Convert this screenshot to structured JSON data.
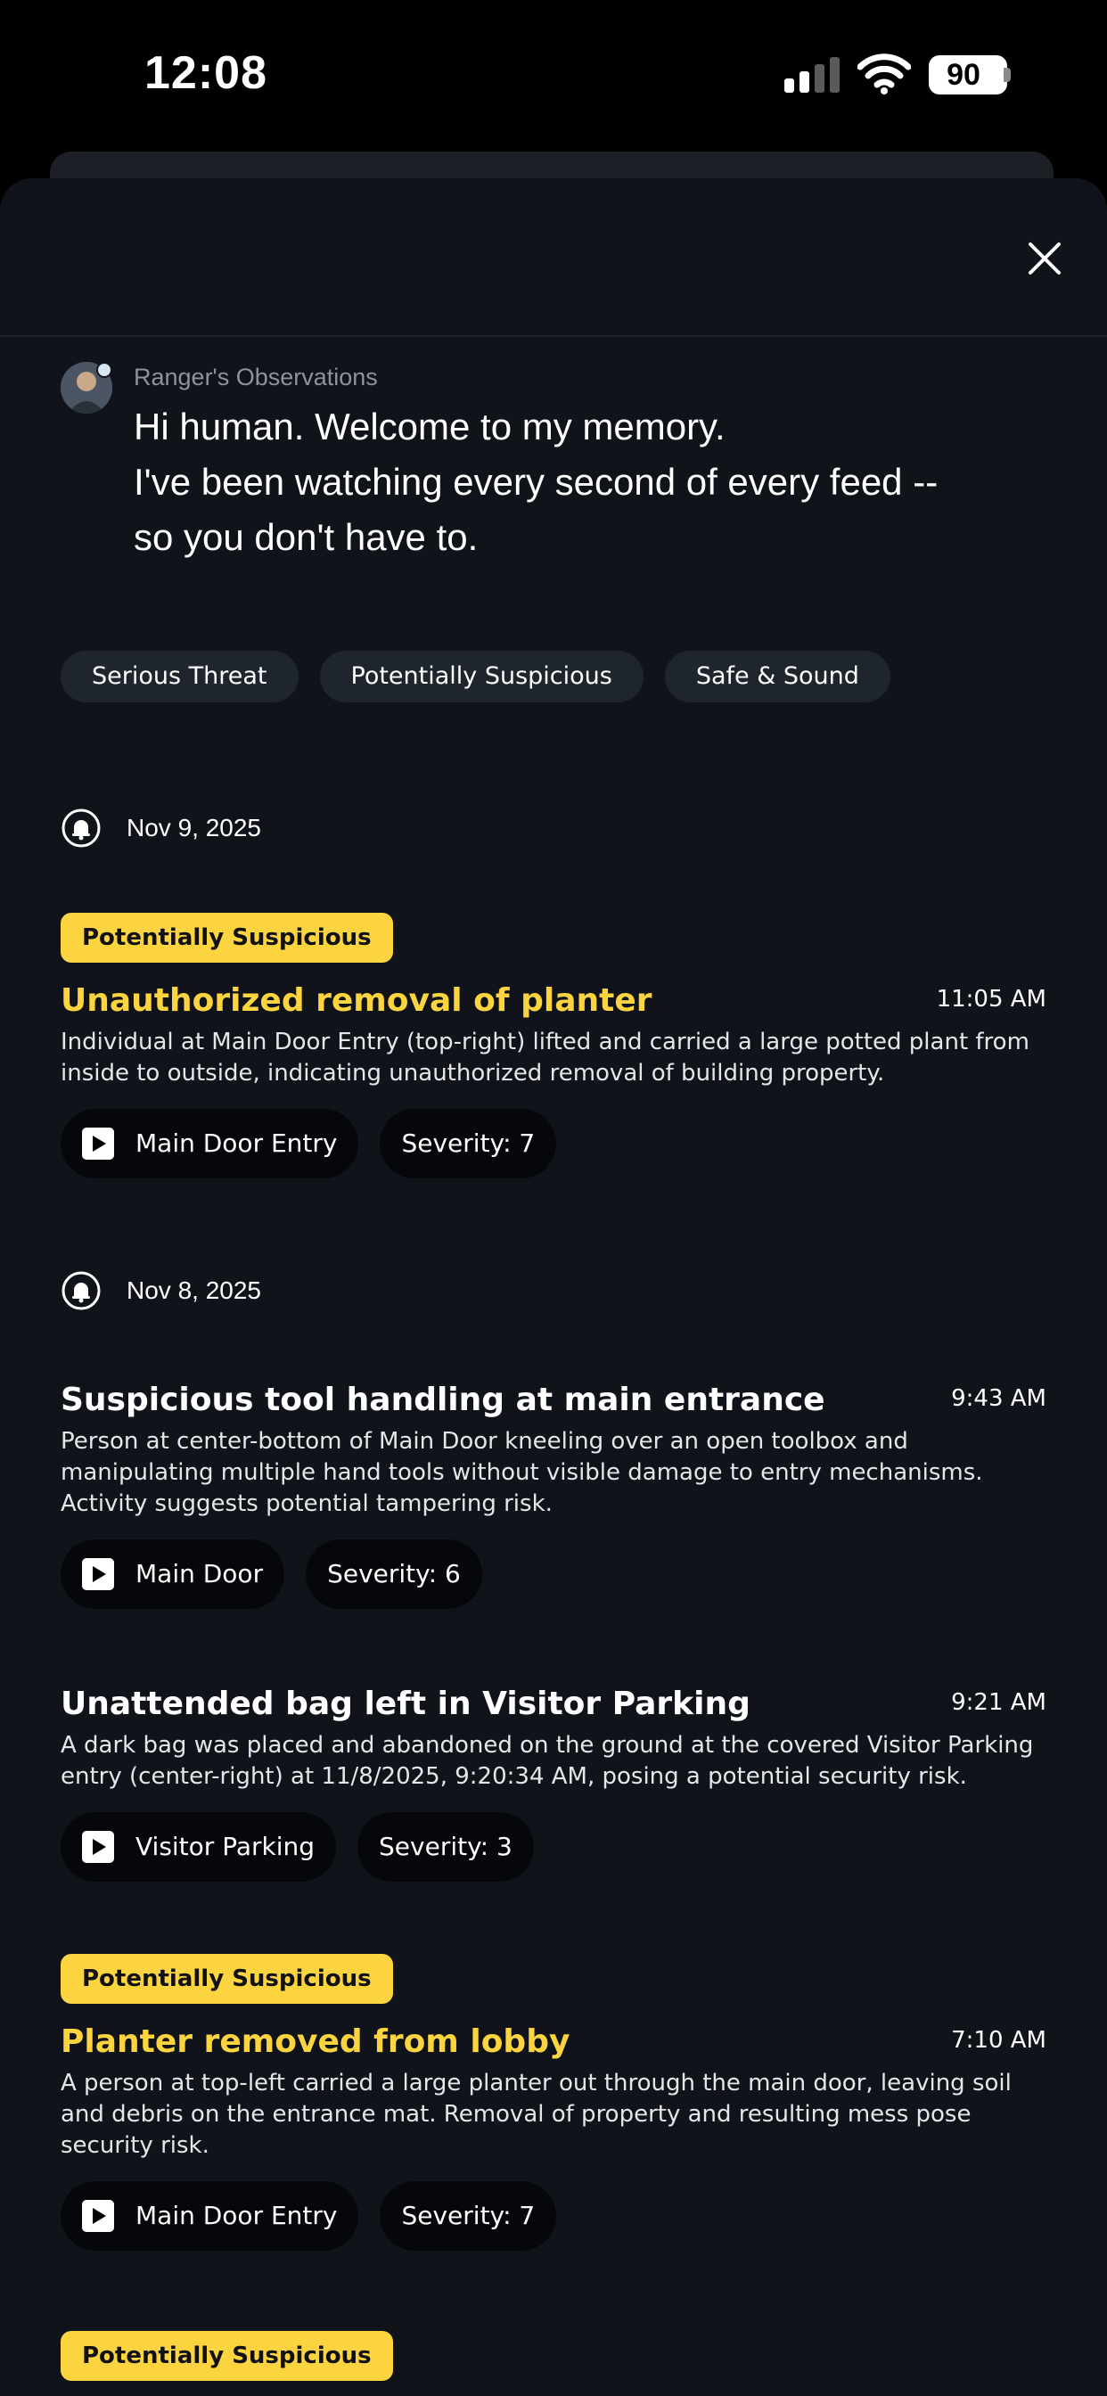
{
  "status_bar": {
    "time": "12:08",
    "battery": "90"
  },
  "observations": {
    "label": "Ranger's Observations",
    "message_lines": [
      "Hi human. Welcome to my memory.",
      "I've been watching every second of every feed --",
      "so you don't have to."
    ]
  },
  "filters": [
    "Serious Threat",
    "Potentially Suspicious",
    "Safe & Sound"
  ],
  "dates": [
    "Nov 9, 2025",
    "Nov 8, 2025"
  ],
  "events": [
    {
      "badge": "Potentially Suspicious",
      "title": "Unauthorized removal of planter",
      "time": "11:05 AM",
      "description_lines": [
        "Individual at Main Door Entry (top-right) lifted and carried a large potted plant from",
        "inside to outside, indicating unauthorized removal of building property."
      ],
      "camera": "Main Door Entry",
      "severity": "Severity: 7"
    },
    {
      "title": "Suspicious tool handling at main entrance",
      "time": "9:43 AM",
      "description_lines": [
        "Person at center-bottom of Main Door kneeling over an open toolbox and",
        "manipulating multiple hand tools without visible damage to entry mechanisms.",
        "Activity suggests potential tampering risk."
      ],
      "camera": "Main Door",
      "severity": "Severity: 6"
    },
    {
      "title": "Unattended bag left in Visitor Parking",
      "time": "9:21 AM",
      "description_lines": [
        "A dark bag was placed and abandoned on the ground at the covered Visitor Parking",
        "entry (center-right) at 11/8/2025, 9:20:34 AM, posing a potential security risk."
      ],
      "camera": "Visitor Parking",
      "severity": "Severity: 3"
    },
    {
      "badge": "Potentially Suspicious",
      "title": "Planter removed from lobby",
      "time": "7:10 AM",
      "description_lines": [
        "A person at top-left carried a large planter out through the main door, leaving soil",
        "and debris on the entrance mat. Removal of property and resulting mess pose",
        "security risk."
      ],
      "camera": "Main Door Entry",
      "severity": "Severity: 7"
    },
    {
      "badge": "Potentially Suspicious"
    }
  ],
  "colors": {
    "background": "#10141a",
    "accent_yellow": "#fbd43f",
    "chip_bg": "#1f252d",
    "pill_bg": "#05070a"
  },
  "icons": [
    "signal-icon",
    "wifi-icon",
    "battery-icon",
    "close-icon",
    "avatar",
    "alarm-bell-icon",
    "play-icon"
  ]
}
